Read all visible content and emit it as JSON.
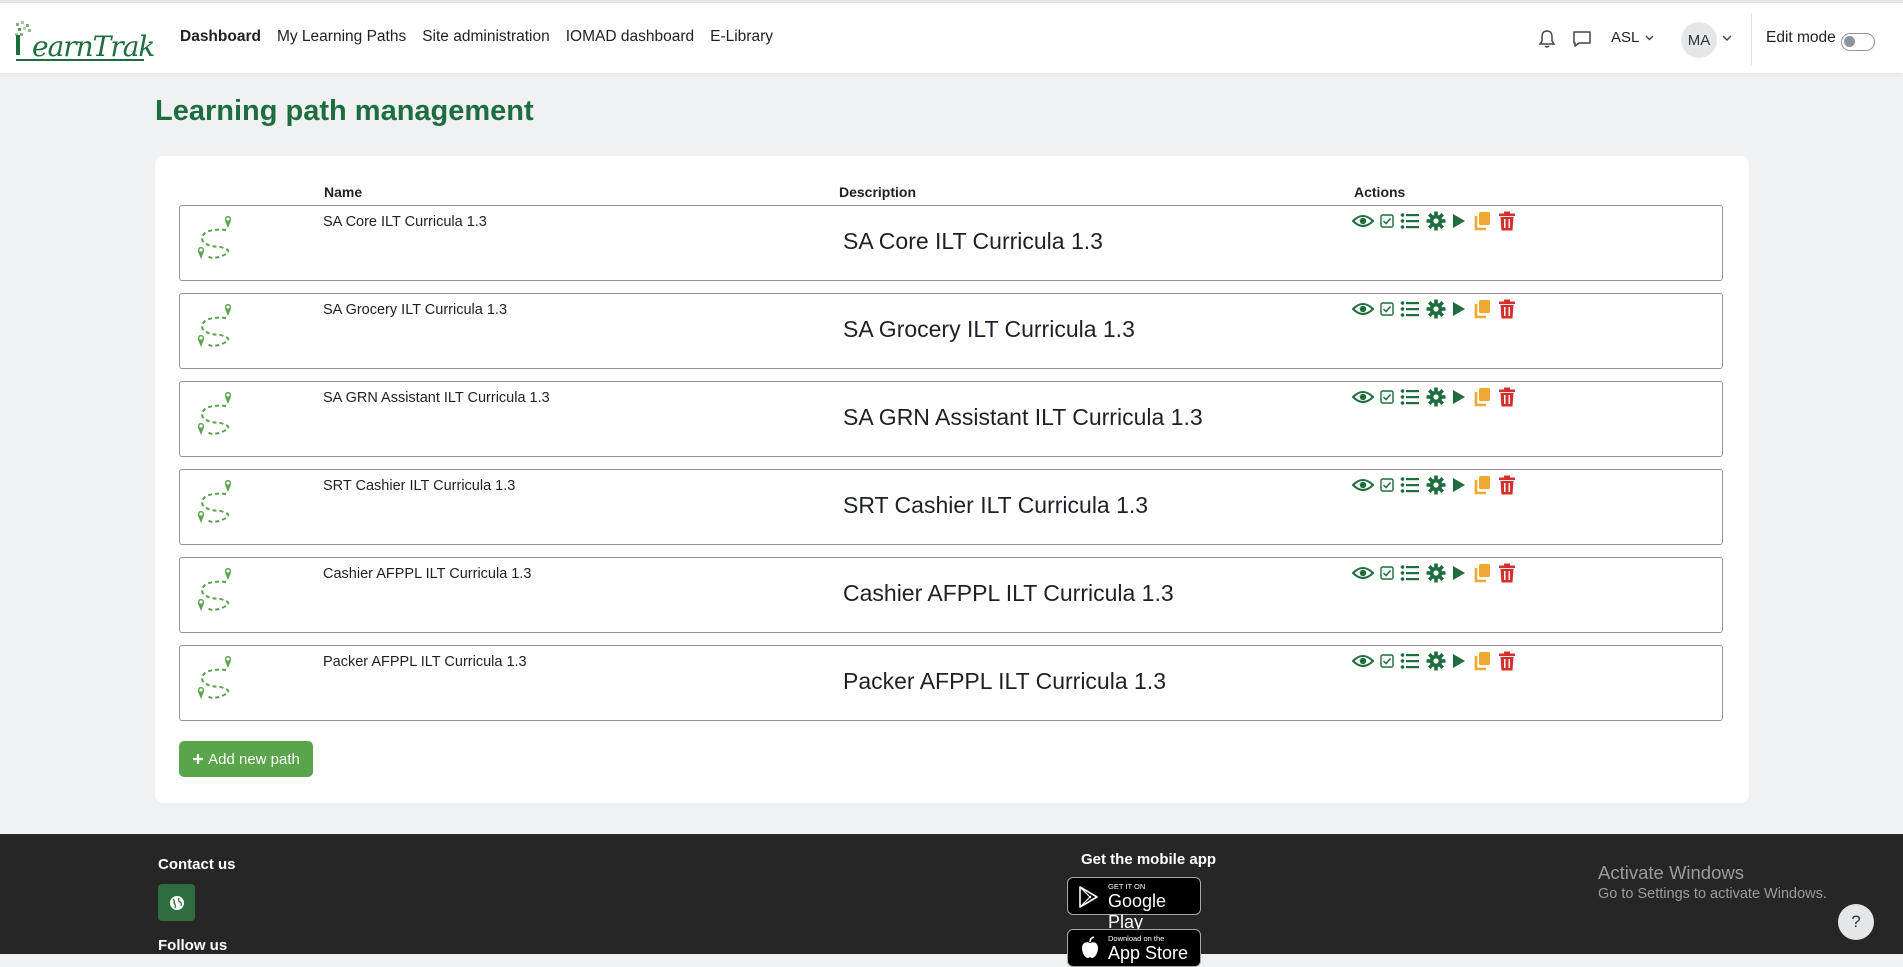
{
  "brand": {
    "logo_text": "earnTrak"
  },
  "nav": {
    "links": [
      "Dashboard",
      "My Learning Paths",
      "Site administration",
      "IOMAD dashboard",
      "E-Library"
    ],
    "language": "ASL",
    "user_initials": "MA",
    "edit_mode_label": "Edit mode"
  },
  "page": {
    "title": "Learning path management",
    "columns": {
      "name": "Name",
      "description": "Description",
      "actions": "Actions"
    },
    "rows": [
      {
        "name": "SA Core ILT Curricula 1.3",
        "description": "SA Core ILT Curricula 1.3"
      },
      {
        "name": "SA Grocery ILT Curricula 1.3",
        "description": "SA Grocery ILT Curricula 1.3"
      },
      {
        "name": "SA GRN Assistant ILT Curricula 1.3",
        "description": "SA GRN Assistant ILT Curricula 1.3"
      },
      {
        "name": "SRT Cashier ILT Curricula 1.3",
        "description": "SRT Cashier ILT Curricula 1.3"
      },
      {
        "name": "Cashier AFPPL ILT Curricula 1.3",
        "description": "Cashier AFPPL ILT Curricula 1.3"
      },
      {
        "name": "Packer AFPPL ILT Curricula 1.3",
        "description": "Packer AFPPL ILT Curricula 1.3"
      }
    ],
    "row_actions": [
      "eye-icon",
      "checkbox-icon",
      "list-icon",
      "gear-icon",
      "play-icon",
      "copy-icon",
      "trash-icon"
    ],
    "add_button_label": "Add new path"
  },
  "footer": {
    "contact_title": "Contact us",
    "follow_title": "Follow us",
    "mobile_title": "Get the mobile app",
    "google_play_small": "GET IT ON",
    "google_play_big": "Google Play",
    "app_store_small": "Download on the",
    "app_store_big": "App Store"
  },
  "windows_watermark": {
    "title": "Activate Windows",
    "subtitle": "Go to Settings to activate Windows."
  },
  "help_label": "?",
  "colors": {
    "brand_green": "#1e6d3f",
    "action_green": "#1e6d3f",
    "copy_orange": "#f0a830",
    "delete_red": "#d32f2f",
    "add_button": "#5aa44c",
    "footer_bg": "#262626"
  }
}
